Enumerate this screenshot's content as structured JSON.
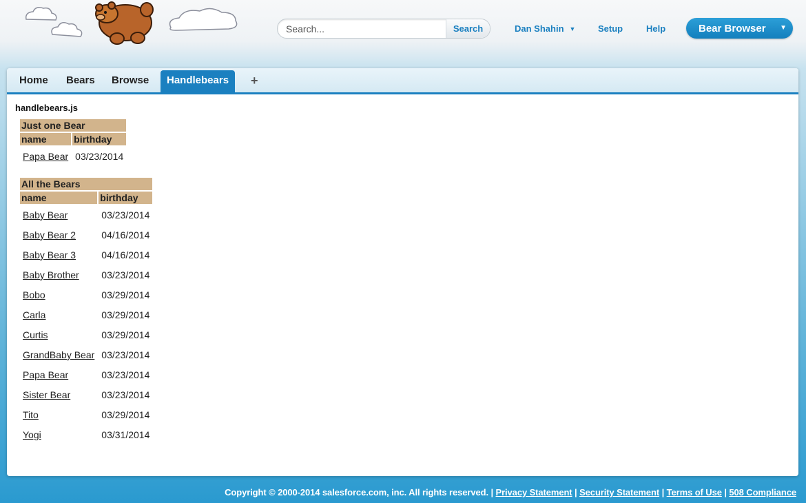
{
  "header": {
    "search": {
      "placeholder": "Search...",
      "value": "",
      "button_label": "Search"
    },
    "user_menu_label": "Dan Shahin",
    "setup_label": "Setup",
    "help_label": "Help",
    "app_switcher_label": "Bear Browser"
  },
  "tabs": [
    {
      "label": "Home"
    },
    {
      "label": "Bears"
    },
    {
      "label": "Browse"
    },
    {
      "label": "Handlebears",
      "active": true
    },
    {
      "label": "+"
    }
  ],
  "page": {
    "title": "handlebears.js",
    "just_one": {
      "heading": "Just one Bear",
      "columns": [
        "name",
        "birthday"
      ],
      "rows": [
        {
          "name": "Papa Bear",
          "birthday": "03/23/2014"
        }
      ]
    },
    "all_bears": {
      "heading": "All the Bears",
      "columns": [
        "name",
        "birthday"
      ],
      "rows": [
        {
          "name": "Baby Bear",
          "birthday": "03/23/2014"
        },
        {
          "name": "Baby Bear 2",
          "birthday": "04/16/2014"
        },
        {
          "name": "Baby Bear 3",
          "birthday": "04/16/2014"
        },
        {
          "name": "Baby Brother",
          "birthday": "03/23/2014"
        },
        {
          "name": "Bobo",
          "birthday": "03/29/2014"
        },
        {
          "name": "Carla",
          "birthday": "03/29/2014"
        },
        {
          "name": "Curtis",
          "birthday": "03/29/2014"
        },
        {
          "name": "GrandBaby Bear",
          "birthday": "03/23/2014"
        },
        {
          "name": "Papa Bear",
          "birthday": "03/23/2014"
        },
        {
          "name": "Sister Bear",
          "birthday": "03/23/2014"
        },
        {
          "name": "Tito",
          "birthday": "03/29/2014"
        },
        {
          "name": "Yogi",
          "birthday": "03/31/2014"
        }
      ]
    }
  },
  "footer": {
    "copyright": "Copyright © 2000-2014 salesforce.com, inc. All rights reserved.",
    "links": [
      "Privacy Statement",
      "Security Statement",
      "Terms of Use",
      "508 Compliance"
    ]
  },
  "colors": {
    "brand_blue": "#1b80c0",
    "table_header_tan": "#d2b48c"
  }
}
